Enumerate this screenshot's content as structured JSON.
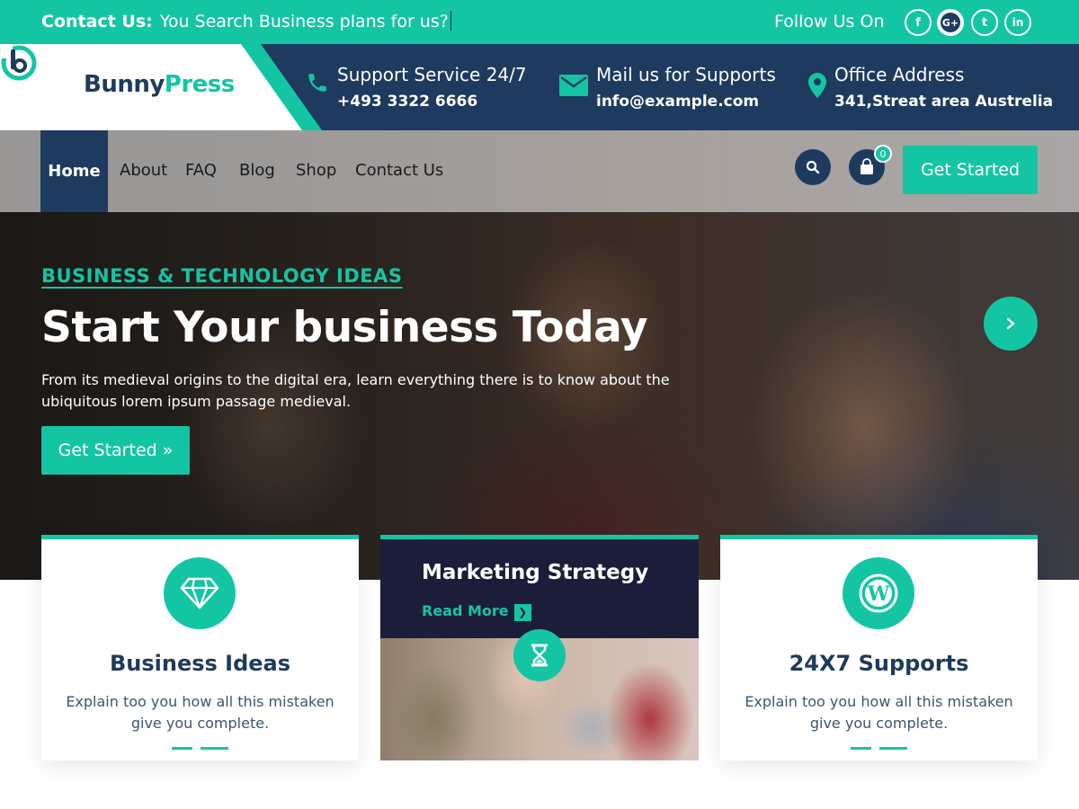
{
  "topbar": {
    "contact_label": "Contact Us:",
    "contact_text": "You Search Business plans for us?",
    "follow_label": "Follow Us On",
    "social": [
      {
        "icon": "facebook-icon",
        "glyph": "f"
      },
      {
        "icon": "google-plus-icon",
        "glyph": "G+"
      },
      {
        "icon": "twitter-icon",
        "glyph": "t"
      },
      {
        "icon": "linkedin-icon",
        "glyph": "in"
      }
    ]
  },
  "brand": {
    "part1": "Bunny",
    "part2": "Press"
  },
  "header_info": [
    {
      "icon": "phone-icon",
      "title": "Support Service 24/7",
      "value": "+493 3322 6666"
    },
    {
      "icon": "mail-icon",
      "title": "Mail us for Supports",
      "value": "info@example.com"
    },
    {
      "icon": "map-pin-icon",
      "title": "Office Address",
      "value": "341,Streat area Austrelia"
    }
  ],
  "nav": {
    "items": [
      "Home",
      "About",
      "FAQ",
      "Blog",
      "Shop",
      "Contact Us"
    ],
    "active": "Home",
    "cart_count": "0",
    "cta": "Get Started"
  },
  "hero": {
    "kicker": "BUSINESS & TECHNOLOGY IDEAS",
    "headline": "Start Your business Today",
    "subtitle": "From its medieval origins to the digital era, learn everything there is to know about the ubiquitous lorem ipsum passage medieval.",
    "cta": "Get Started »"
  },
  "cards": [
    {
      "icon": "diamond-icon",
      "title": "Business Ideas",
      "text": "Explain too you how all this mistaken give you complete."
    },
    {
      "icon": "hourglass-icon",
      "title": "Marketing Strategy",
      "link": "Read More"
    },
    {
      "icon": "wordpress-icon",
      "title": "24X7 Supports",
      "text": "Explain too you how all this mistaken give you complete."
    }
  ],
  "colors": {
    "accent": "#14c5a4",
    "navy": "#1f3a5f",
    "dark_card": "#1c1d3a"
  }
}
